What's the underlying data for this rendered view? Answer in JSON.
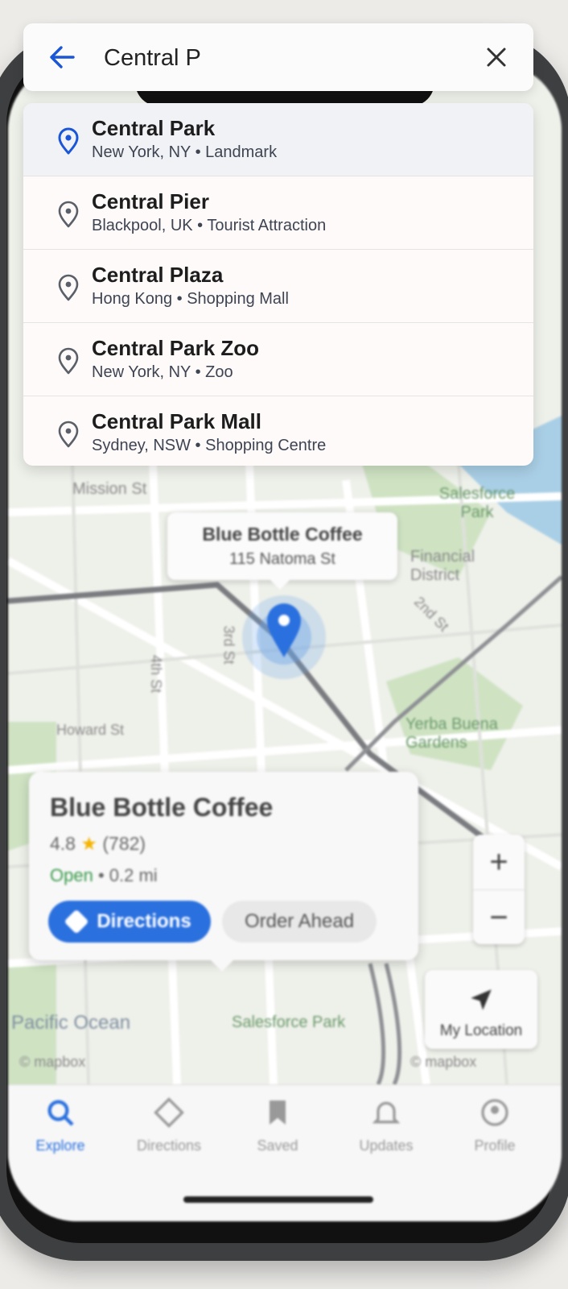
{
  "colors": {
    "accent": "#1a56d6",
    "pin_default": "#5b5f67",
    "map_bg": "#eef0ea",
    "park": "#cfe3c3",
    "water": "#a9cfe6"
  },
  "search": {
    "value": "Central P",
    "back_icon": "arrow-left-icon",
    "clear_icon": "close-icon"
  },
  "results": [
    {
      "name": "Central Park",
      "location": "New York, NY",
      "category": "Landmark",
      "subtitle": "New York, NY • Landmark",
      "highlighted": true
    },
    {
      "name": "Central Pier",
      "location": "Blackpool, UK",
      "category": "Tourist Attraction",
      "subtitle": "Blackpool, UK • Tourist Attraction",
      "highlighted": false
    },
    {
      "name": "Central Plaza",
      "location": "Hong Kong",
      "category": "Shopping Mall",
      "subtitle": "Hong Kong • Shopping Mall",
      "highlighted": false
    },
    {
      "name": "Central Park Zoo",
      "location": "New York, NY",
      "category": "Zoo",
      "subtitle": "New York, NY • Zoo",
      "highlighted": false
    },
    {
      "name": "Central Park Mall",
      "location": "Sydney, NSW",
      "category": "Shopping Centre",
      "subtitle": "Sydney, NSW • Shopping Centre",
      "highlighted": false
    }
  ],
  "map": {
    "pin_callout": {
      "title": "Blue Bottle Coffee",
      "address": "115 Natoma St"
    },
    "labels": {
      "mission_st": "Mission St",
      "salesforce_park_top": "Salesforce Park",
      "financial_district": "Financial District",
      "yerba_buena": "Yerba Buena Gardens",
      "pacific_ocean": "Pacific Ocean",
      "salesforce_park_bottom": "Salesforce Park",
      "street_3rd": "3rd St",
      "street_4th": "4th St",
      "street_2nd": "2nd St",
      "howard": "Howard St"
    },
    "attribution_left": "© mapbox",
    "attribution_right": "© mapbox"
  },
  "place_card": {
    "title": "Blue Bottle Coffee",
    "rating": "4.8",
    "reviews": "(782)",
    "status": "Open",
    "distance": "• 0.2 mi",
    "directions_label": "Directions",
    "order_label": "Order Ahead"
  },
  "controls": {
    "zoom_in": "+",
    "zoom_out": "−",
    "my_location": "My Location"
  },
  "tabs": [
    {
      "label": "Explore",
      "icon": "search-icon",
      "active": true
    },
    {
      "label": "Directions",
      "icon": "directions-icon",
      "active": false
    },
    {
      "label": "Saved",
      "icon": "bookmark-icon",
      "active": false
    },
    {
      "label": "Updates",
      "icon": "bell-icon",
      "active": false
    },
    {
      "label": "Profile",
      "icon": "profile-icon",
      "active": false
    }
  ]
}
